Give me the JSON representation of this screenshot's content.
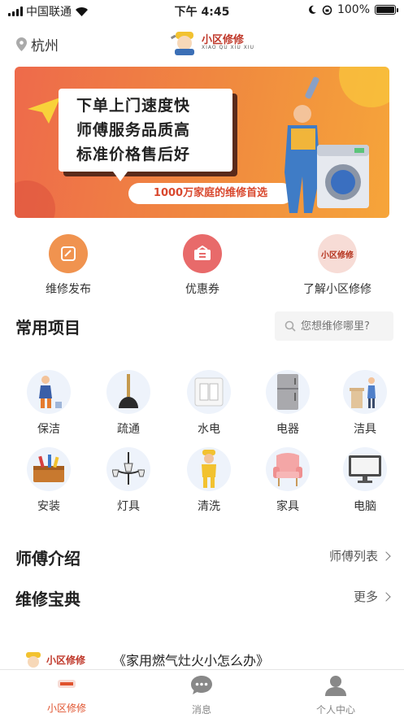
{
  "status_bar": {
    "carrier": "中国联通",
    "time": "下午 4:45",
    "battery": "100%"
  },
  "header": {
    "location": "杭州",
    "brand_name": "小区修修",
    "brand_sub": "XIAO QU XIU XIU"
  },
  "banner": {
    "lines": [
      "下单上门速度快",
      "师傅服务品质高",
      "标准价格售后好"
    ],
    "tagline": "1000万家庭的维修首选"
  },
  "quick_actions": [
    {
      "label": "维修发布",
      "icon": "edit-icon"
    },
    {
      "label": "优惠券",
      "icon": "coupon-icon"
    },
    {
      "label": "了解小区修修",
      "icon": "brand-logo-icon",
      "logo_text": "小区修修"
    }
  ],
  "common": {
    "title": "常用项目",
    "search_placeholder": "您想维修哪里?",
    "items": [
      {
        "label": "保洁",
        "icon": "cleaning-icon"
      },
      {
        "label": "疏通",
        "icon": "plunger-icon"
      },
      {
        "label": "水电",
        "icon": "switch-icon"
      },
      {
        "label": "电器",
        "icon": "fridge-icon"
      },
      {
        "label": "洁具",
        "icon": "sink-icon"
      },
      {
        "label": "安装",
        "icon": "toolbox-icon"
      },
      {
        "label": "灯具",
        "icon": "chandelier-icon"
      },
      {
        "label": "清洗",
        "icon": "worker-icon"
      },
      {
        "label": "家具",
        "icon": "armchair-icon"
      },
      {
        "label": "电脑",
        "icon": "monitor-icon"
      }
    ]
  },
  "masters": {
    "title": "师傅介绍",
    "link": "师傅列表"
  },
  "guide": {
    "title": "维修宝典",
    "link": "更多"
  },
  "article": {
    "title": "《家用燃气灶火小怎么办》",
    "logo_text": "小区修修"
  },
  "tabbar": [
    {
      "label": "小区修修",
      "icon": "home-logo-icon",
      "active": true
    },
    {
      "label": "消息",
      "icon": "message-icon",
      "active": false
    },
    {
      "label": "个人中心",
      "icon": "user-icon",
      "active": false
    }
  ],
  "colors": {
    "accent": "#e0532e",
    "banner_start": "#ee6a4b",
    "banner_end": "#f6a53a"
  }
}
